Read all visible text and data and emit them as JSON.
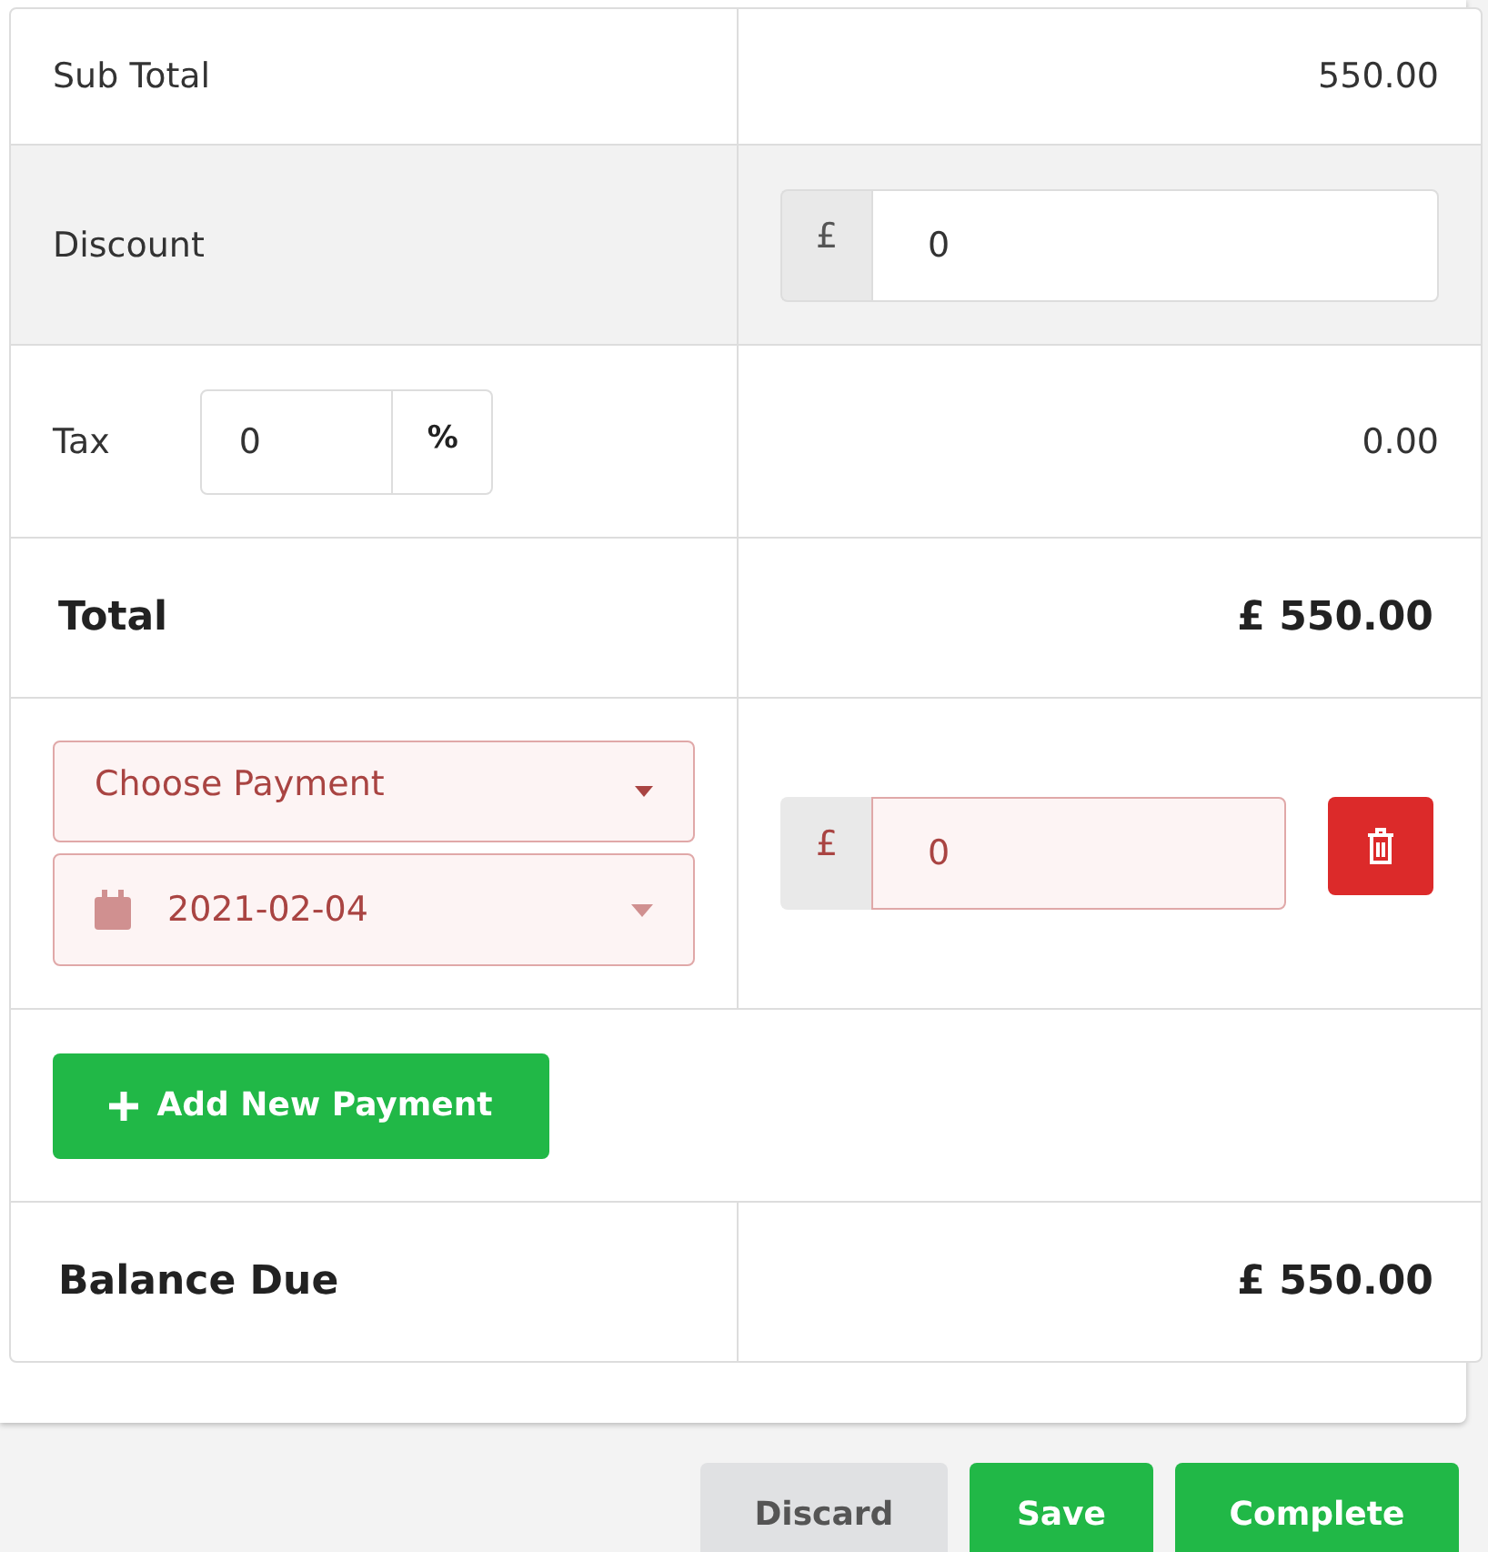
{
  "subtotal": {
    "label": "Sub Total",
    "value": "550.00"
  },
  "discount": {
    "label": "Discount",
    "currency": "£",
    "value": "0"
  },
  "tax": {
    "label": "Tax",
    "value": "0",
    "unit": "%",
    "amount": "0.00"
  },
  "total": {
    "label": "Total",
    "value": "£ 550.00"
  },
  "payments": [
    {
      "method": {
        "placeholder": "Choose Payment"
      },
      "date": "2021-02-04",
      "currency": "£",
      "amount": "0",
      "invalid": true
    }
  ],
  "add_payment_button": {
    "label": "Add New Payment"
  },
  "balance_due": {
    "label": "Balance Due",
    "value": "£ 550.00"
  },
  "actions": [
    {
      "label": "Discard",
      "kind": "secondary"
    },
    {
      "label": "Save",
      "kind": "primary"
    },
    {
      "label": "Complete",
      "kind": "primary"
    }
  ]
}
